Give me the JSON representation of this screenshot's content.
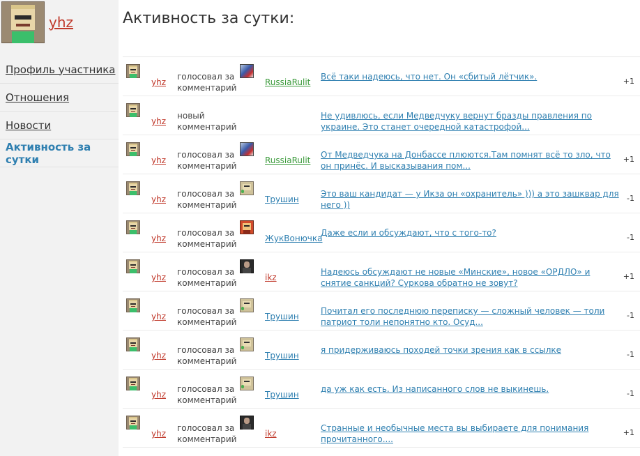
{
  "profile": {
    "username": "yhz"
  },
  "nav": {
    "items": [
      {
        "label": "Профиль участника",
        "active": false
      },
      {
        "label": "Отношения",
        "active": false
      },
      {
        "label": "Новости",
        "active": false
      },
      {
        "label": "Активность за сутки",
        "active": true
      }
    ]
  },
  "page": {
    "title": "Активность за сутки:"
  },
  "colors": {
    "accent": "#2e7fb0",
    "username": "#c0392b",
    "green_user": "#3a9a3a",
    "link_user": "#2e7fb0"
  },
  "activity": [
    {
      "user": "yhz",
      "action": "голосовал за комментарий",
      "target": "RussiaRulit",
      "target_avatar": "russia-flag-avatar",
      "target_color": "#3a9a3a",
      "comment": "Всё таки надеюсь, что нет. Он «сбитый лётчик».",
      "vote": "+1"
    },
    {
      "user": "yhz",
      "action": "новый комментарий",
      "target": "",
      "target_avatar": "",
      "target_color": "",
      "comment": "Не удивлюсь, если Медведчуку вернут бразды правления по украине. Это станет очередной катастрофой...",
      "vote": ""
    },
    {
      "user": "yhz",
      "action": "голосовал за комментарий",
      "target": "RussiaRulit",
      "target_avatar": "russia-flag-avatar",
      "target_color": "#3a9a3a",
      "comment": "От Медведчука на Донбассе плюются.Там помнят всё то зло, что он принёс. И высказывания пом...",
      "vote": "+1"
    },
    {
      "user": "yhz",
      "action": "голосовал за комментарий",
      "target": "Трушин",
      "target_avatar": "trushin-avatar",
      "target_color": "#2e7fb0",
      "comment": "Это ваш кандидат — у Икза он «охранитель» ))) а это зашквар для него ))",
      "vote": "-1"
    },
    {
      "user": "yhz",
      "action": "голосовал за комментарий",
      "target": "ЖукВонючка",
      "target_avatar": "zhuk-avatar",
      "target_color": "#2e7fb0",
      "comment": "Даже если и обсуждают, что с того-то?",
      "vote": "-1"
    },
    {
      "user": "yhz",
      "action": "голосовал за комментарий",
      "target": "ikz",
      "target_avatar": "ikz-avatar",
      "target_color": "#c0392b",
      "comment": "Надеюсь обсуждают не новые «Минские», новое «ОРДЛО» и снятие санкций? Суркова обратно не зовут?",
      "vote": "+1"
    },
    {
      "user": "yhz",
      "action": "голосовал за комментарий",
      "target": "Трушин",
      "target_avatar": "trushin-avatar",
      "target_color": "#2e7fb0",
      "comment": "Почитал его последнюю переписку — сложный человек — толи патриот толи непонятно кто.  Осуд...",
      "vote": "-1"
    },
    {
      "user": "yhz",
      "action": "голосовал за комментарий",
      "target": "Трушин",
      "target_avatar": "trushin-avatar",
      "target_color": "#2e7fb0",
      "comment": "я придерживаюсь походей точки зрения как в ссылке",
      "vote": "-1"
    },
    {
      "user": "yhz",
      "action": "голосовал за комментарий",
      "target": "Трушин",
      "target_avatar": "trushin-avatar",
      "target_color": "#2e7fb0",
      "comment": "да уж как есть. Из написанного слов не выкинешь.",
      "vote": "-1"
    },
    {
      "user": "yhz",
      "action": "голосовал за комментарий",
      "target": "ikz",
      "target_avatar": "ikz-avatar",
      "target_color": "#c0392b",
      "comment": "Странные и необычные места вы выбираете для понимания прочитанного....",
      "vote": "+1"
    }
  ]
}
